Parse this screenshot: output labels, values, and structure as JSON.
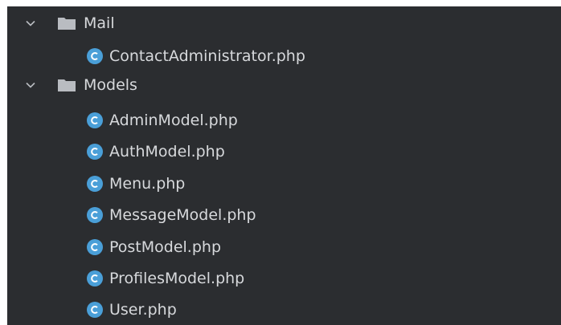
{
  "tree": {
    "folders": [
      {
        "name": "Mail",
        "expanded": true,
        "files": [
          "ContactAdministrator.php"
        ]
      },
      {
        "name": "Models",
        "expanded": true,
        "files": [
          "AdminModel.php",
          "AuthModel.php",
          "Menu.php",
          "MessageModel.php",
          "PostModel.php",
          "ProfilesModel.php",
          "User.php"
        ]
      }
    ]
  },
  "icons": {
    "expand": "chevron-down-icon",
    "folder": "folder-icon",
    "php_class": "php-class-icon"
  },
  "colors": {
    "background": "#2b2d30",
    "text": "#d7d9dc",
    "folder": "#b9bcc1",
    "class_badge": "#4a9fd8"
  }
}
